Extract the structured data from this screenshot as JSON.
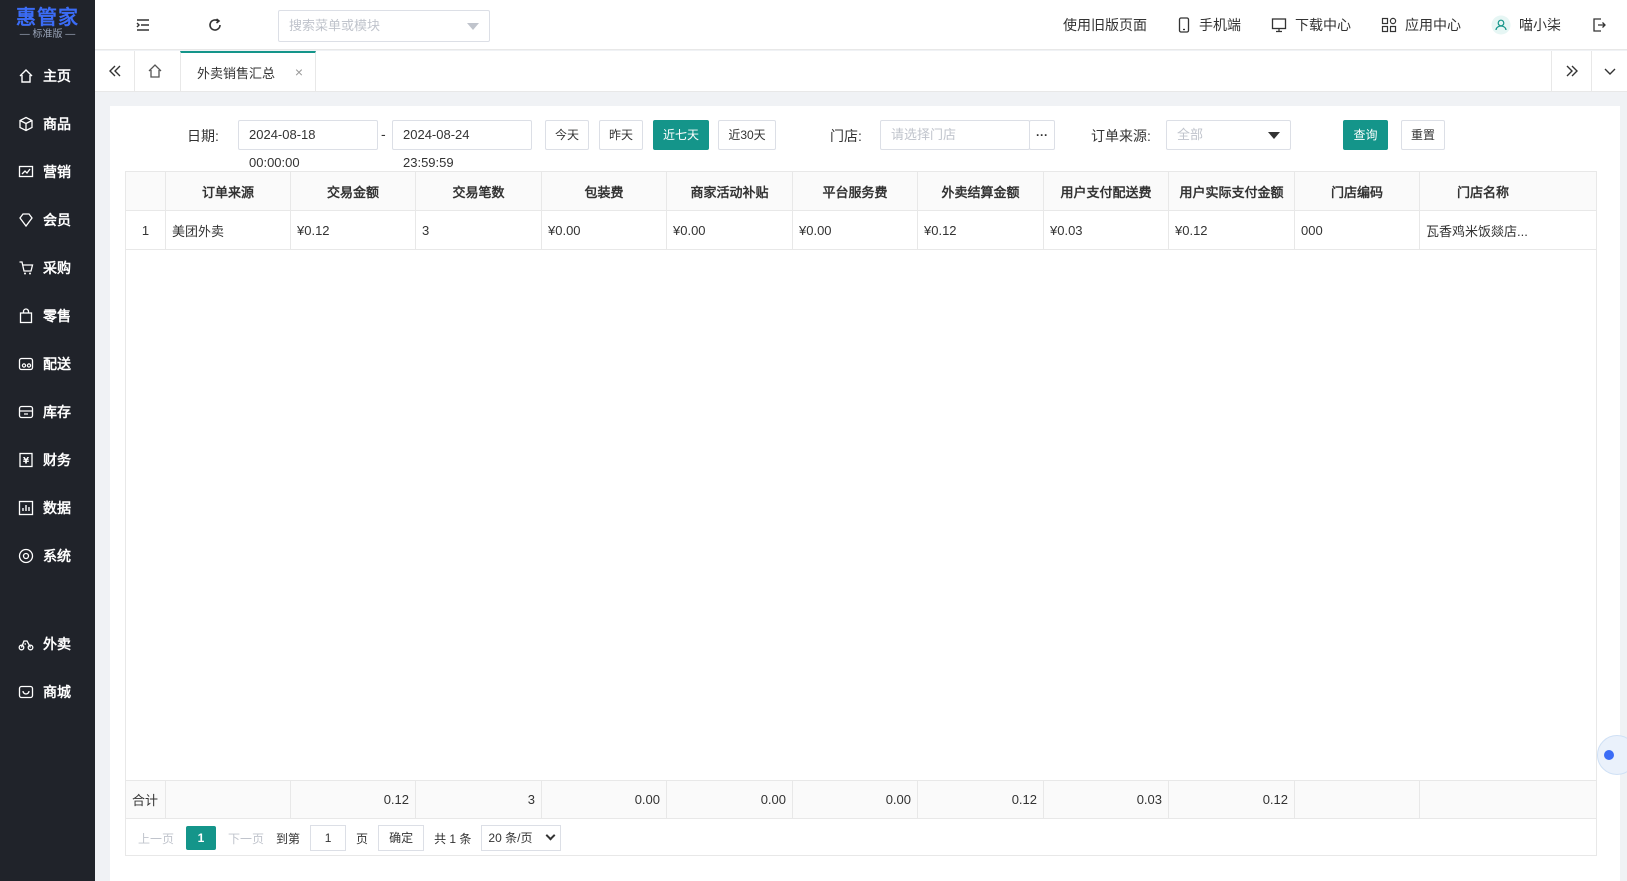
{
  "sidebar": {
    "logo_main": "惠管家",
    "logo_sub": "— 标准版 —",
    "items": [
      {
        "label": "主页",
        "icon": "home-icon"
      },
      {
        "label": "商品",
        "icon": "cube-icon"
      },
      {
        "label": "营销",
        "icon": "chart-icon"
      },
      {
        "label": "会员",
        "icon": "diamond-icon"
      },
      {
        "label": "采购",
        "icon": "cart-icon"
      },
      {
        "label": "零售",
        "icon": "bag-icon"
      },
      {
        "label": "配送",
        "icon": "delivery-icon"
      },
      {
        "label": "库存",
        "icon": "box-icon"
      },
      {
        "label": "财务",
        "icon": "finance-icon"
      },
      {
        "label": "数据",
        "icon": "data-icon"
      },
      {
        "label": "系统",
        "icon": "settings-icon"
      },
      {
        "label": "外卖",
        "icon": "bike-icon"
      },
      {
        "label": "商城",
        "icon": "store-icon"
      }
    ]
  },
  "topbar": {
    "search_placeholder": "搜索菜单或模块",
    "old_page": "使用旧版页面",
    "mobile": "手机端",
    "download": "下载中心",
    "apps": "应用中心",
    "user": "喵小柒"
  },
  "tabs": {
    "active": "外卖销售汇总"
  },
  "filter": {
    "date_label": "日期:",
    "start": "2024-08-18 00:00:00",
    "sep": "-",
    "end": "2024-08-24 23:59:59",
    "today": "今天",
    "yesterday": "昨天",
    "last7": "近七天",
    "last30": "近30天",
    "store_label": "门店:",
    "store_placeholder": "请选择门店",
    "store_more": "···",
    "source_label": "订单来源:",
    "source_value": "全部",
    "query": "查询",
    "reset": "重置"
  },
  "table": {
    "headers": [
      "",
      "订单来源",
      "交易金额",
      "交易笔数",
      "包装费",
      "商家活动补贴",
      "平台服务费",
      "外卖结算金额",
      "用户支付配送费",
      "用户实际支付金额",
      "门店编码",
      "门店名称"
    ],
    "rows": [
      [
        "1",
        "美团外卖",
        "¥0.12",
        "3",
        "¥0.00",
        "¥0.00",
        "¥0.00",
        "¥0.12",
        "¥0.03",
        "¥0.12",
        "000",
        "瓦香鸡米饭燚店..."
      ]
    ],
    "summary": [
      "合计",
      "",
      "0.12",
      "3",
      "0.00",
      "0.00",
      "0.00",
      "0.12",
      "0.03",
      "0.12",
      "",
      ""
    ]
  },
  "pager": {
    "prev": "上一页",
    "current": "1",
    "next": "下一页",
    "goto": "到第",
    "page_input": "1",
    "page_unit": "页",
    "confirm": "确定",
    "total": "共 1 条",
    "page_size": "20 条/页"
  }
}
